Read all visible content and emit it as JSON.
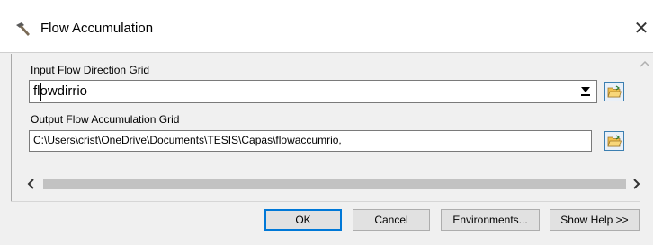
{
  "window": {
    "title": "Flow Accumulation",
    "close_glyph": "✕",
    "icon": "hammer-icon"
  },
  "form": {
    "input_label": "Input Flow Direction Grid",
    "input_value": "flowdirrio",
    "output_label": "Output Flow Accumulation Grid",
    "output_value": "C:\\Users\\crist\\OneDrive\\Documents\\TESIS\\Capas\\flowaccumrio,"
  },
  "buttons": {
    "ok": "OK",
    "cancel": "Cancel",
    "environments": "Environments...",
    "show_help": "Show Help >>"
  },
  "colors": {
    "accent": "#0078d7",
    "folder": "#f2c14e"
  }
}
